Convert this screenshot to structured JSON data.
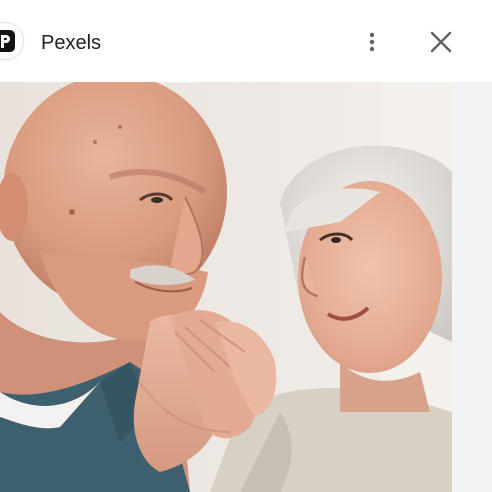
{
  "header": {
    "site_name": "Pexels",
    "logo_icon": "pexels-logo-icon",
    "more_icon": "more-vert-icon",
    "close_icon": "close-icon"
  },
  "image": {
    "subject": "elderly-couple-holding-hands-photo"
  },
  "colors": {
    "logo_bg": "#111111",
    "text": "#202124",
    "icon": "#5f6368"
  }
}
